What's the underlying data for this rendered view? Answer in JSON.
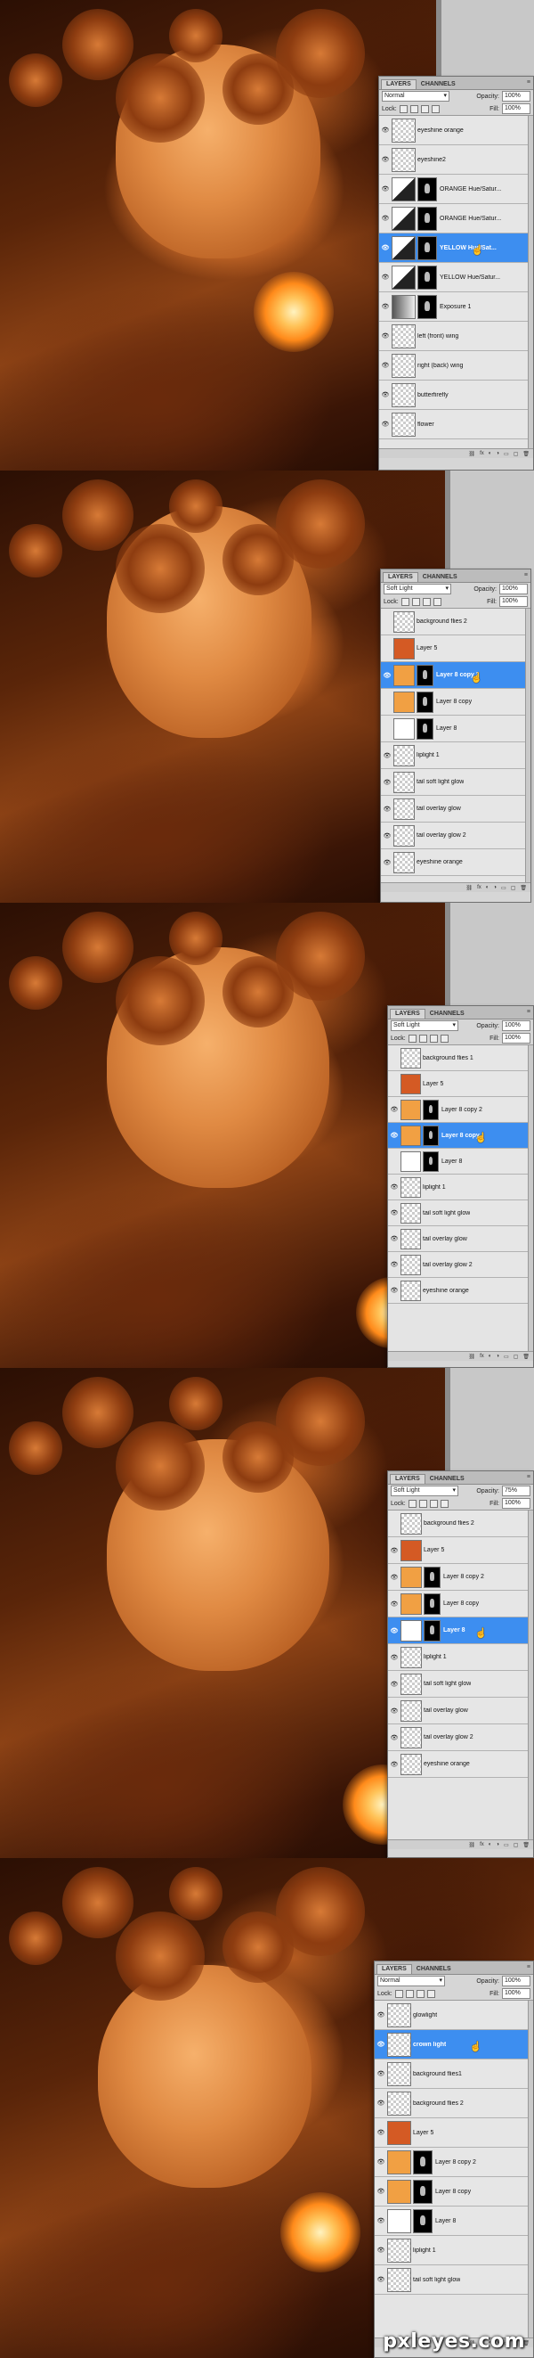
{
  "watermark": "pxleyes.com",
  "panel_labels": {
    "tab_layers": "LAYERS",
    "tab_channels": "CHANNELS",
    "opacity_label": "Opacity:",
    "fill_label": "Fill:",
    "lock_label": "Lock:",
    "menu_icon": "menu-icon",
    "bottom_icons": [
      "link-icon",
      "fx-icon",
      "mask-icon",
      "adjustment-icon",
      "folder-icon",
      "new-layer-icon",
      "trash-icon"
    ]
  },
  "steps": [
    {
      "blend_mode": "Normal",
      "opacity": "100%",
      "fill": "100%",
      "layers": [
        {
          "name": "eyeshine orange",
          "thumb": "trans",
          "mask": false,
          "visible": true,
          "selected": false
        },
        {
          "name": "eyeshine2",
          "thumb": "trans",
          "mask": false,
          "visible": true,
          "selected": false
        },
        {
          "name": "ORANGE Hue/Satur...",
          "thumb": "adj",
          "mask": true,
          "visible": true,
          "selected": false
        },
        {
          "name": "ORANGE Hue/Satur...",
          "thumb": "adj",
          "mask": true,
          "visible": true,
          "selected": false
        },
        {
          "name": "YELLOW Hue/Sat...",
          "thumb": "adj",
          "mask": true,
          "visible": true,
          "selected": true
        },
        {
          "name": "YELLOW Hue/Satur...",
          "thumb": "adj",
          "mask": true,
          "visible": true,
          "selected": false
        },
        {
          "name": "Exposure 1",
          "thumb": "adjb",
          "mask": true,
          "visible": true,
          "selected": false
        },
        {
          "name": "left (front) wing",
          "thumb": "trans",
          "mask": false,
          "visible": true,
          "selected": false
        },
        {
          "name": "right (back) wing",
          "thumb": "trans",
          "mask": false,
          "visible": true,
          "selected": false
        },
        {
          "name": "butterfirefly",
          "thumb": "trans",
          "mask": false,
          "visible": true,
          "selected": false
        },
        {
          "name": "flower",
          "thumb": "trans",
          "mask": false,
          "visible": true,
          "selected": false
        }
      ]
    },
    {
      "blend_mode": "Soft Light",
      "opacity": "100%",
      "fill": "100%",
      "layers": [
        {
          "name": "background flies 2",
          "thumb": "trans",
          "mask": false,
          "visible": false,
          "selected": false
        },
        {
          "name": "Layer 5",
          "thumb": "red",
          "mask": false,
          "visible": false,
          "selected": false
        },
        {
          "name": "Layer 8 copy 2",
          "thumb": "orange",
          "mask": true,
          "visible": true,
          "selected": true
        },
        {
          "name": "Layer 8 copy",
          "thumb": "orange",
          "mask": true,
          "visible": false,
          "selected": false
        },
        {
          "name": "Layer 8",
          "thumb": "white",
          "mask": true,
          "visible": false,
          "selected": false
        },
        {
          "name": "liplight 1",
          "thumb": "trans",
          "mask": false,
          "visible": true,
          "selected": false
        },
        {
          "name": "tail soft light glow",
          "thumb": "trans",
          "mask": false,
          "visible": true,
          "selected": false
        },
        {
          "name": "tail overlay glow",
          "thumb": "trans",
          "mask": false,
          "visible": true,
          "selected": false
        },
        {
          "name": "tail overlay glow 2",
          "thumb": "trans",
          "mask": false,
          "visible": true,
          "selected": false
        },
        {
          "name": "eyeshine orange",
          "thumb": "trans",
          "mask": false,
          "visible": true,
          "selected": false
        }
      ]
    },
    {
      "blend_mode": "Soft Light",
      "opacity": "100%",
      "fill": "100%",
      "layers": [
        {
          "name": "background flies 1",
          "thumb": "trans",
          "mask": false,
          "visible": false,
          "selected": false
        },
        {
          "name": "Layer 5",
          "thumb": "red",
          "mask": false,
          "visible": false,
          "selected": false
        },
        {
          "name": "Layer 8 copy 2",
          "thumb": "orange",
          "mask": true,
          "visible": true,
          "selected": false
        },
        {
          "name": "Layer 8 copy",
          "thumb": "orange",
          "mask": true,
          "visible": true,
          "selected": true
        },
        {
          "name": "Layer 8",
          "thumb": "white",
          "mask": true,
          "visible": false,
          "selected": false
        },
        {
          "name": "liplight 1",
          "thumb": "trans",
          "mask": false,
          "visible": true,
          "selected": false
        },
        {
          "name": "tail soft light glow",
          "thumb": "trans",
          "mask": false,
          "visible": true,
          "selected": false
        },
        {
          "name": "tail overlay glow",
          "thumb": "trans",
          "mask": false,
          "visible": true,
          "selected": false
        },
        {
          "name": "tail overlay glow 2",
          "thumb": "trans",
          "mask": false,
          "visible": true,
          "selected": false
        },
        {
          "name": "eyeshine orange",
          "thumb": "trans",
          "mask": false,
          "visible": true,
          "selected": false
        }
      ]
    },
    {
      "blend_mode": "Soft Light",
      "opacity": "75%",
      "fill": "100%",
      "layers": [
        {
          "name": "background flies 2",
          "thumb": "trans",
          "mask": false,
          "visible": false,
          "selected": false
        },
        {
          "name": "Layer 5",
          "thumb": "red",
          "mask": false,
          "visible": true,
          "selected": false
        },
        {
          "name": "Layer 8 copy 2",
          "thumb": "orange",
          "mask": true,
          "visible": true,
          "selected": false
        },
        {
          "name": "Layer 8 copy",
          "thumb": "orange",
          "mask": true,
          "visible": true,
          "selected": false
        },
        {
          "name": "Layer 8",
          "thumb": "white",
          "mask": true,
          "visible": true,
          "selected": true
        },
        {
          "name": "liplight 1",
          "thumb": "trans",
          "mask": false,
          "visible": true,
          "selected": false
        },
        {
          "name": "tail soft light glow",
          "thumb": "trans",
          "mask": false,
          "visible": true,
          "selected": false
        },
        {
          "name": "tail overlay glow",
          "thumb": "trans",
          "mask": false,
          "visible": true,
          "selected": false
        },
        {
          "name": "tail overlay glow 2",
          "thumb": "trans",
          "mask": false,
          "visible": true,
          "selected": false
        },
        {
          "name": "eyeshine orange",
          "thumb": "trans",
          "mask": false,
          "visible": true,
          "selected": false
        }
      ]
    },
    {
      "blend_mode": "Normal",
      "opacity": "100%",
      "fill": "100%",
      "layers": [
        {
          "name": "glowlight",
          "thumb": "trans",
          "mask": false,
          "visible": true,
          "selected": false
        },
        {
          "name": "crown light",
          "thumb": "trans",
          "mask": false,
          "visible": true,
          "selected": true
        },
        {
          "name": "background flies1",
          "thumb": "trans",
          "mask": false,
          "visible": true,
          "selected": false
        },
        {
          "name": "background flies 2",
          "thumb": "trans",
          "mask": false,
          "visible": true,
          "selected": false
        },
        {
          "name": "Layer 5",
          "thumb": "red",
          "mask": false,
          "visible": true,
          "selected": false
        },
        {
          "name": "Layer 8 copy 2",
          "thumb": "orange",
          "mask": true,
          "visible": true,
          "selected": false
        },
        {
          "name": "Layer 8 copy",
          "thumb": "orange",
          "mask": true,
          "visible": true,
          "selected": false
        },
        {
          "name": "Layer 8",
          "thumb": "white",
          "mask": true,
          "visible": true,
          "selected": false
        },
        {
          "name": "liplight 1",
          "thumb": "trans",
          "mask": false,
          "visible": true,
          "selected": false
        },
        {
          "name": "tail soft light glow",
          "thumb": "trans",
          "mask": false,
          "visible": true,
          "selected": false
        }
      ]
    }
  ]
}
